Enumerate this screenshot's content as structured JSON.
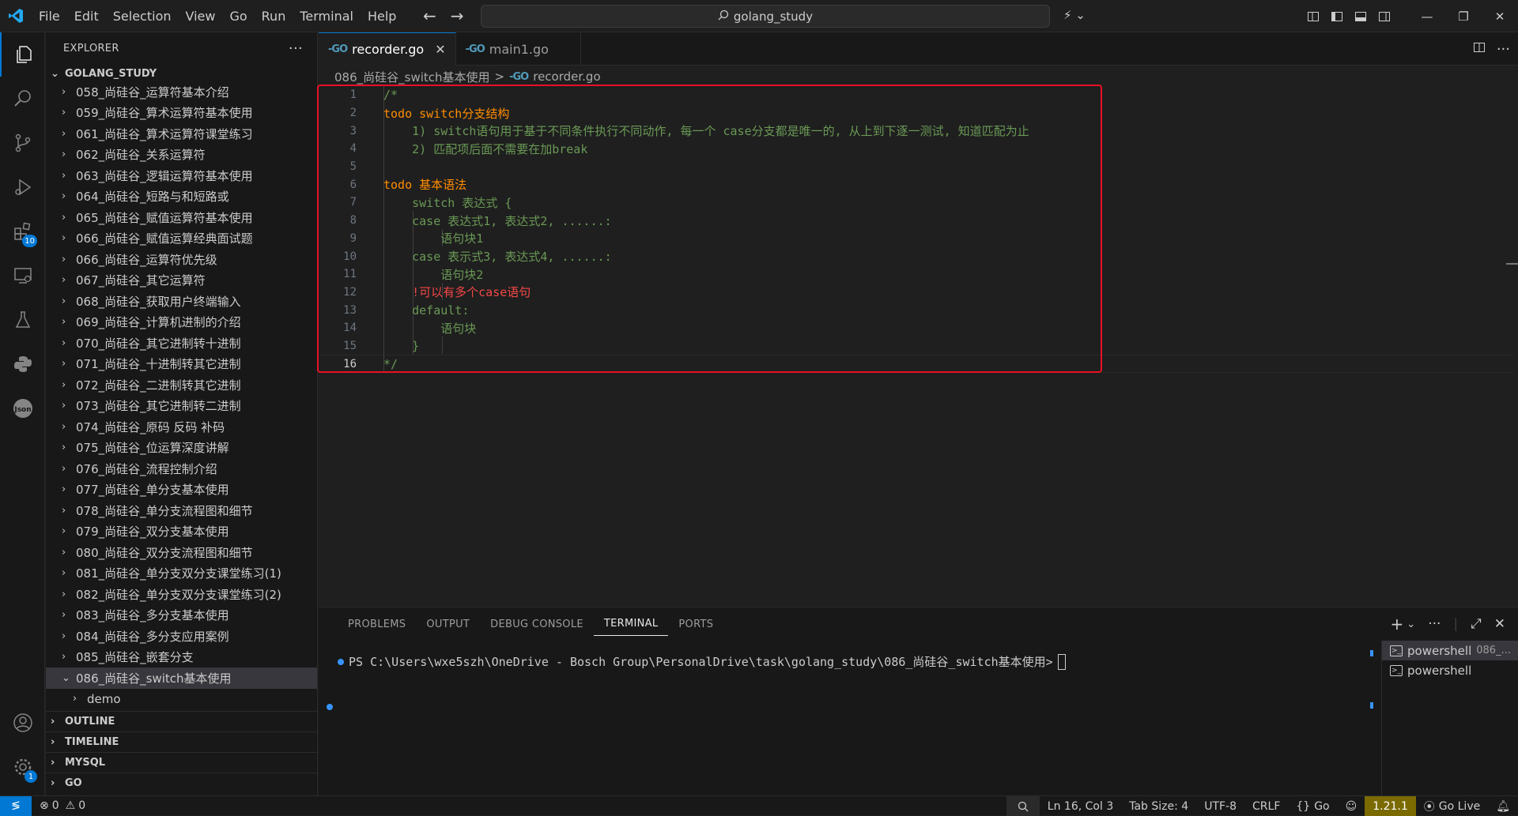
{
  "titlebar": {
    "menu": [
      "File",
      "Edit",
      "Selection",
      "View",
      "Go",
      "Run",
      "Terminal",
      "Help"
    ],
    "search_text": "golang_study"
  },
  "activity": {
    "extensions_badge": "10",
    "settings_badge": "1"
  },
  "sidebar": {
    "title": "EXPLORER",
    "root": "GOLANG_STUDY",
    "items": [
      "058_尚硅谷_运算符基本介绍",
      "059_尚硅谷_算术运算符基本使用",
      "061_尚硅谷_算术运算符课堂练习",
      "062_尚硅谷_关系运算符",
      "063_尚硅谷_逻辑运算符基本使用",
      "064_尚硅谷_短路与和短路或",
      "065_尚硅谷_赋值运算符基本使用",
      "066_尚硅谷_赋值运算经典面试题",
      "066_尚硅谷_运算符优先级",
      "067_尚硅谷_其它运算符",
      "068_尚硅谷_获取用户终端输入",
      "069_尚硅谷_计算机进制的介绍",
      "070_尚硅谷_其它进制转十进制",
      "071_尚硅谷_十进制转其它进制",
      "072_尚硅谷_二进制转其它进制",
      "073_尚硅谷_其它进制转二进制",
      "074_尚硅谷_原码 反码 补码",
      "075_尚硅谷_位运算深度讲解",
      "076_尚硅谷_流程控制介绍",
      "077_尚硅谷_单分支基本使用",
      "078_尚硅谷_单分支流程图和细节",
      "079_尚硅谷_双分支基本使用",
      "080_尚硅谷_双分支流程图和细节",
      "081_尚硅谷_单分支双分支课堂练习(1)",
      "082_尚硅谷_单分支双分支课堂练习(2)",
      "083_尚硅谷_多分支基本使用",
      "084_尚硅谷_多分支应用案例",
      "085_尚硅谷_嵌套分支",
      "086_尚硅谷_switch基本使用"
    ],
    "child": "demo",
    "sections": [
      "OUTLINE",
      "TIMELINE",
      "MYSQL",
      "GO"
    ]
  },
  "editor": {
    "tabs": [
      {
        "label": "recorder.go"
      },
      {
        "label": "main1.go"
      }
    ],
    "breadcrumb": {
      "folder": "086_尚硅谷_switch基本使用",
      "sep": ">",
      "file": "recorder.go"
    },
    "lines": [
      {
        "n": "1",
        "text": "/*"
      },
      {
        "n": "2",
        "text": "todo switch分支结构"
      },
      {
        "n": "3",
        "text": "    1) switch语句用于基于不同条件执行不同动作, 每一个 case分支都是唯一的, 从上到下逐一测试, 知道匹配为止"
      },
      {
        "n": "4",
        "text": "    2) 匹配项后面不需要在加break"
      },
      {
        "n": "5",
        "text": ""
      },
      {
        "n": "6",
        "text": "todo 基本语法"
      },
      {
        "n": "7",
        "text": "    switch 表达式 {"
      },
      {
        "n": "8",
        "text": "    case 表达式1, 表达式2, ......:"
      },
      {
        "n": "9",
        "text": "        语句块1"
      },
      {
        "n": "10",
        "text": "    case 表示式3, 表达式4, ......:"
      },
      {
        "n": "11",
        "text": "        语句块2"
      },
      {
        "n": "12",
        "text": "    !可以有多个case语句"
      },
      {
        "n": "13",
        "text": "    default:"
      },
      {
        "n": "14",
        "text": "        语句块"
      },
      {
        "n": "15",
        "text": "    }"
      },
      {
        "n": "16",
        "text": "*/"
      }
    ]
  },
  "panel": {
    "tabs": [
      "PROBLEMS",
      "OUTPUT",
      "DEBUG CONSOLE",
      "TERMINAL",
      "PORTS"
    ],
    "prompt": "PS C:\\Users\\wxe5szh\\OneDrive - Bosch Group\\PersonalDrive\\task\\golang_study\\086_尚硅谷_switch基本使用>",
    "terminals": [
      {
        "name": "powershell",
        "sub": "086_..."
      },
      {
        "name": "powershell",
        "sub": ""
      }
    ]
  },
  "statusbar": {
    "errors": "0",
    "warnings": "0",
    "position": "Ln 16, Col 3",
    "tab_size": "Tab Size: 4",
    "encoding": "UTF-8",
    "eol": "CRLF",
    "language": "Go",
    "version": "1.21.1",
    "golive": "Go Live"
  },
  "colors": {
    "accent": "#0078d4",
    "comment_green": "#6a9955",
    "todo_orange": "#ff8c00",
    "highlight_red": "#f44747",
    "annotation_box": "#e81123"
  }
}
